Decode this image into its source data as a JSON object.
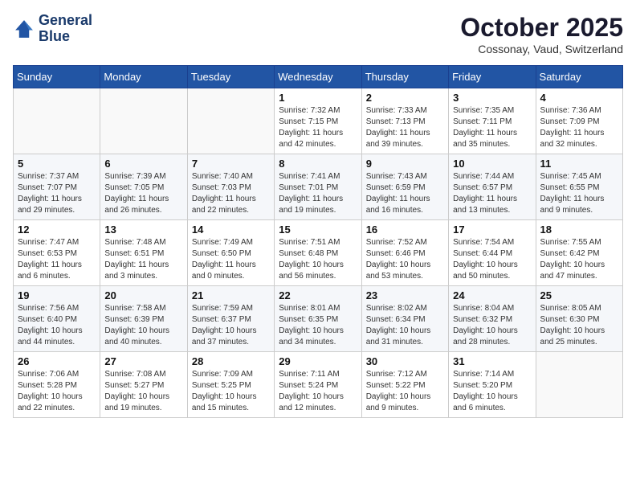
{
  "header": {
    "logo_line1": "General",
    "logo_line2": "Blue",
    "month": "October 2025",
    "location": "Cossonay, Vaud, Switzerland"
  },
  "days_of_week": [
    "Sunday",
    "Monday",
    "Tuesday",
    "Wednesday",
    "Thursday",
    "Friday",
    "Saturday"
  ],
  "weeks": [
    [
      {
        "day": "",
        "info": ""
      },
      {
        "day": "",
        "info": ""
      },
      {
        "day": "",
        "info": ""
      },
      {
        "day": "1",
        "info": "Sunrise: 7:32 AM\nSunset: 7:15 PM\nDaylight: 11 hours\nand 42 minutes."
      },
      {
        "day": "2",
        "info": "Sunrise: 7:33 AM\nSunset: 7:13 PM\nDaylight: 11 hours\nand 39 minutes."
      },
      {
        "day": "3",
        "info": "Sunrise: 7:35 AM\nSunset: 7:11 PM\nDaylight: 11 hours\nand 35 minutes."
      },
      {
        "day": "4",
        "info": "Sunrise: 7:36 AM\nSunset: 7:09 PM\nDaylight: 11 hours\nand 32 minutes."
      }
    ],
    [
      {
        "day": "5",
        "info": "Sunrise: 7:37 AM\nSunset: 7:07 PM\nDaylight: 11 hours\nand 29 minutes."
      },
      {
        "day": "6",
        "info": "Sunrise: 7:39 AM\nSunset: 7:05 PM\nDaylight: 11 hours\nand 26 minutes."
      },
      {
        "day": "7",
        "info": "Sunrise: 7:40 AM\nSunset: 7:03 PM\nDaylight: 11 hours\nand 22 minutes."
      },
      {
        "day": "8",
        "info": "Sunrise: 7:41 AM\nSunset: 7:01 PM\nDaylight: 11 hours\nand 19 minutes."
      },
      {
        "day": "9",
        "info": "Sunrise: 7:43 AM\nSunset: 6:59 PM\nDaylight: 11 hours\nand 16 minutes."
      },
      {
        "day": "10",
        "info": "Sunrise: 7:44 AM\nSunset: 6:57 PM\nDaylight: 11 hours\nand 13 minutes."
      },
      {
        "day": "11",
        "info": "Sunrise: 7:45 AM\nSunset: 6:55 PM\nDaylight: 11 hours\nand 9 minutes."
      }
    ],
    [
      {
        "day": "12",
        "info": "Sunrise: 7:47 AM\nSunset: 6:53 PM\nDaylight: 11 hours\nand 6 minutes."
      },
      {
        "day": "13",
        "info": "Sunrise: 7:48 AM\nSunset: 6:51 PM\nDaylight: 11 hours\nand 3 minutes."
      },
      {
        "day": "14",
        "info": "Sunrise: 7:49 AM\nSunset: 6:50 PM\nDaylight: 11 hours\nand 0 minutes."
      },
      {
        "day": "15",
        "info": "Sunrise: 7:51 AM\nSunset: 6:48 PM\nDaylight: 10 hours\nand 56 minutes."
      },
      {
        "day": "16",
        "info": "Sunrise: 7:52 AM\nSunset: 6:46 PM\nDaylight: 10 hours\nand 53 minutes."
      },
      {
        "day": "17",
        "info": "Sunrise: 7:54 AM\nSunset: 6:44 PM\nDaylight: 10 hours\nand 50 minutes."
      },
      {
        "day": "18",
        "info": "Sunrise: 7:55 AM\nSunset: 6:42 PM\nDaylight: 10 hours\nand 47 minutes."
      }
    ],
    [
      {
        "day": "19",
        "info": "Sunrise: 7:56 AM\nSunset: 6:40 PM\nDaylight: 10 hours\nand 44 minutes."
      },
      {
        "day": "20",
        "info": "Sunrise: 7:58 AM\nSunset: 6:39 PM\nDaylight: 10 hours\nand 40 minutes."
      },
      {
        "day": "21",
        "info": "Sunrise: 7:59 AM\nSunset: 6:37 PM\nDaylight: 10 hours\nand 37 minutes."
      },
      {
        "day": "22",
        "info": "Sunrise: 8:01 AM\nSunset: 6:35 PM\nDaylight: 10 hours\nand 34 minutes."
      },
      {
        "day": "23",
        "info": "Sunrise: 8:02 AM\nSunset: 6:34 PM\nDaylight: 10 hours\nand 31 minutes."
      },
      {
        "day": "24",
        "info": "Sunrise: 8:04 AM\nSunset: 6:32 PM\nDaylight: 10 hours\nand 28 minutes."
      },
      {
        "day": "25",
        "info": "Sunrise: 8:05 AM\nSunset: 6:30 PM\nDaylight: 10 hours\nand 25 minutes."
      }
    ],
    [
      {
        "day": "26",
        "info": "Sunrise: 7:06 AM\nSunset: 5:28 PM\nDaylight: 10 hours\nand 22 minutes."
      },
      {
        "day": "27",
        "info": "Sunrise: 7:08 AM\nSunset: 5:27 PM\nDaylight: 10 hours\nand 19 minutes."
      },
      {
        "day": "28",
        "info": "Sunrise: 7:09 AM\nSunset: 5:25 PM\nDaylight: 10 hours\nand 15 minutes."
      },
      {
        "day": "29",
        "info": "Sunrise: 7:11 AM\nSunset: 5:24 PM\nDaylight: 10 hours\nand 12 minutes."
      },
      {
        "day": "30",
        "info": "Sunrise: 7:12 AM\nSunset: 5:22 PM\nDaylight: 10 hours\nand 9 minutes."
      },
      {
        "day": "31",
        "info": "Sunrise: 7:14 AM\nSunset: 5:20 PM\nDaylight: 10 hours\nand 6 minutes."
      },
      {
        "day": "",
        "info": ""
      }
    ]
  ]
}
